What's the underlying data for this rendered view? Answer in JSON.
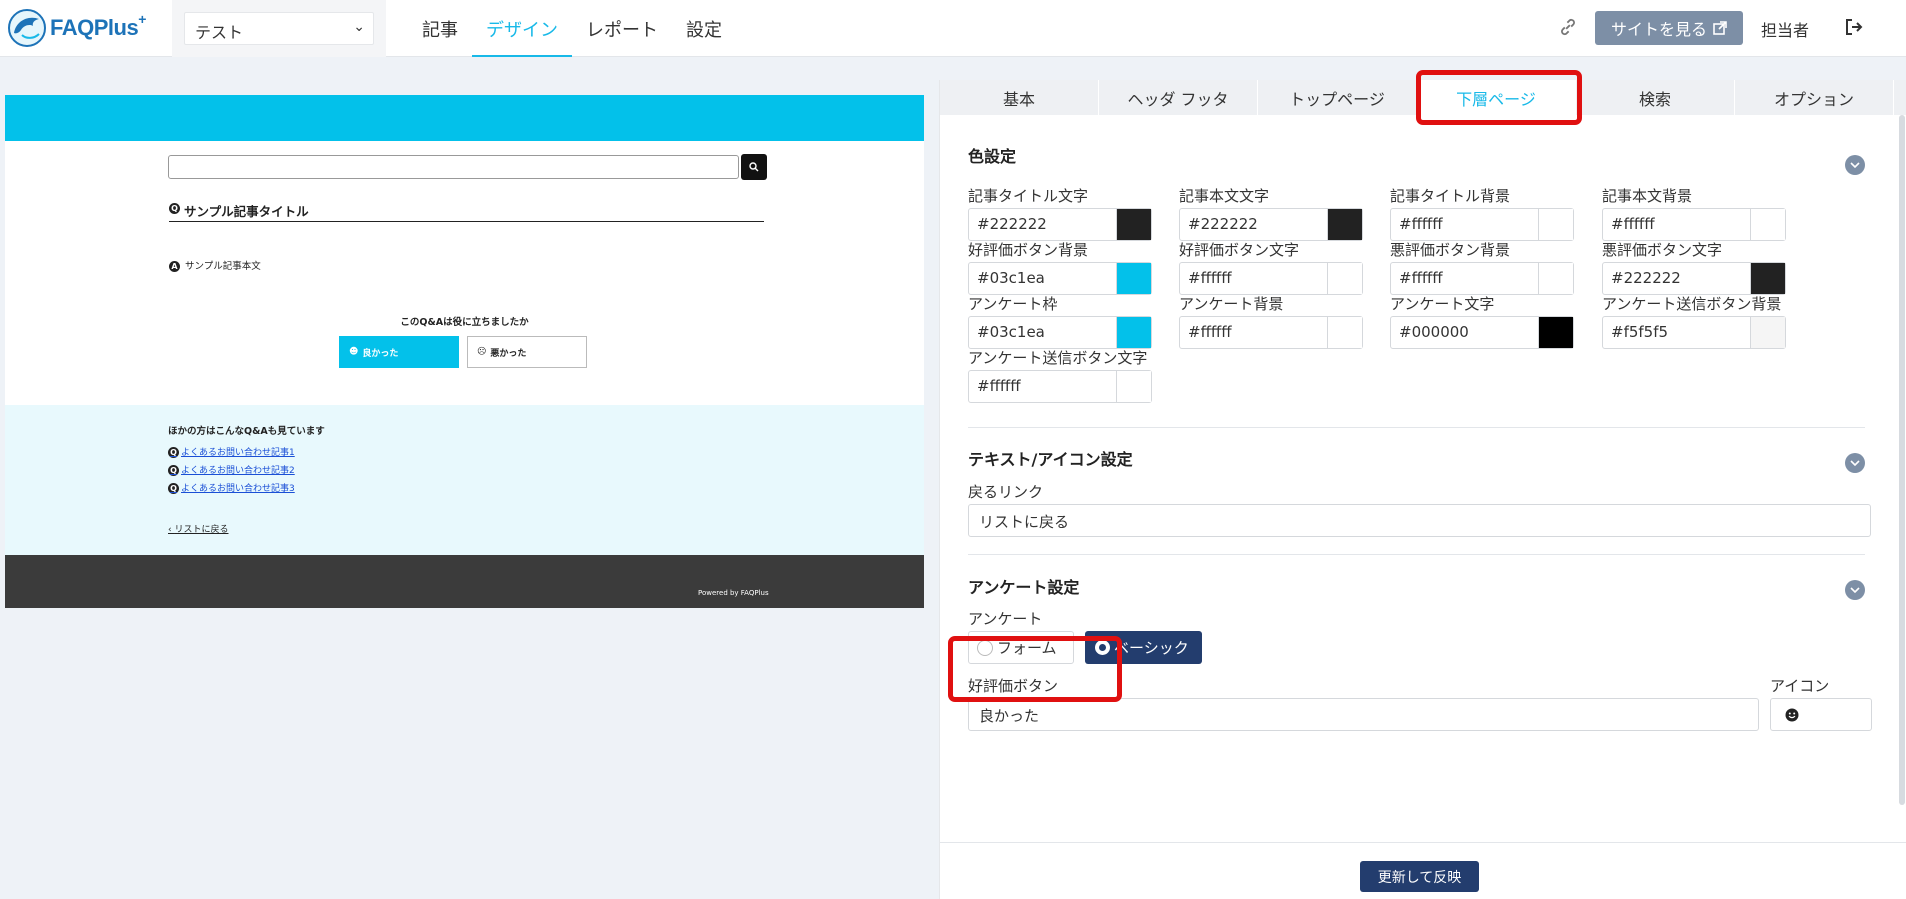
{
  "header": {
    "logo_text": "FAQPlus",
    "logo_sup": "+",
    "site_select_value": "テスト",
    "nav": [
      {
        "label": "記事"
      },
      {
        "label": "デザイン"
      },
      {
        "label": "レポート"
      },
      {
        "label": "設定"
      }
    ],
    "view_site_label": "サイトを見る",
    "user_label": "担当者"
  },
  "preview": {
    "article_title": "サンプル記事タイトル",
    "article_body": "サンプル記事本文",
    "survey_question": "このQ&Aは役に立ちましたか",
    "good_label": "良かった",
    "bad_label": "悪かった",
    "related_title": "ほかの方はこんなQ&Aも見ています",
    "related_links": [
      "よくあるお問い合わせ記事1",
      "よくあるお問い合わせ記事2",
      "よくあるお問い合わせ記事3"
    ],
    "back_link": "リストに戻る",
    "powered_by": "Powered by FAQPlus"
  },
  "settings": {
    "tabs": [
      {
        "label": "基本"
      },
      {
        "label": "ヘッダ フッタ"
      },
      {
        "label": "トップページ"
      },
      {
        "label": "下層ページ"
      },
      {
        "label": "検索"
      },
      {
        "label": "オプション"
      }
    ],
    "color_section_title": "色設定",
    "colors": [
      {
        "label": "記事タイトル文字",
        "value": "#222222",
        "swatch": "#222222"
      },
      {
        "label": "記事本文文字",
        "value": "#222222",
        "swatch": "#222222"
      },
      {
        "label": "記事タイトル背景",
        "value": "#ffffff",
        "swatch": "#ffffff"
      },
      {
        "label": "記事本文背景",
        "value": "#ffffff",
        "swatch": "#ffffff"
      },
      {
        "label": "好評価ボタン背景",
        "value": "#03c1ea",
        "swatch": "#03c1ea"
      },
      {
        "label": "好評価ボタン文字",
        "value": "#ffffff",
        "swatch": "#ffffff"
      },
      {
        "label": "悪評価ボタン背景",
        "value": "#ffffff",
        "swatch": "#ffffff"
      },
      {
        "label": "悪評価ボタン文字",
        "value": "#222222",
        "swatch": "#222222"
      },
      {
        "label": "アンケート枠",
        "value": "#03c1ea",
        "swatch": "#03c1ea"
      },
      {
        "label": "アンケート背景",
        "value": "#ffffff",
        "swatch": "#ffffff"
      },
      {
        "label": "アンケート文字",
        "value": "#000000",
        "swatch": "#000000"
      },
      {
        "label": "アンケート送信ボタン背景",
        "value": "#f5f5f5",
        "swatch": "#f5f5f5"
      },
      {
        "label": "アンケート送信ボタン文字",
        "value": "#ffffff",
        "swatch": "#ffffff"
      }
    ],
    "text_section_title": "テキスト/アイコン設定",
    "back_link_label": "戻るリンク",
    "back_link_value": "リストに戻る",
    "survey_section_title": "アンケート設定",
    "survey_label": "アンケート",
    "survey_option_form": "フォーム",
    "survey_option_basic": "ベーシック",
    "good_button_label": "好評価ボタン",
    "good_button_value": "良かった",
    "icon_label": "アイコン",
    "update_button": "更新して反映"
  },
  "colors": {
    "accent": "#18b9e8",
    "preview_header": "#03c1ea",
    "navy_button": "#233d6e",
    "highlight_red": "#e01010"
  }
}
